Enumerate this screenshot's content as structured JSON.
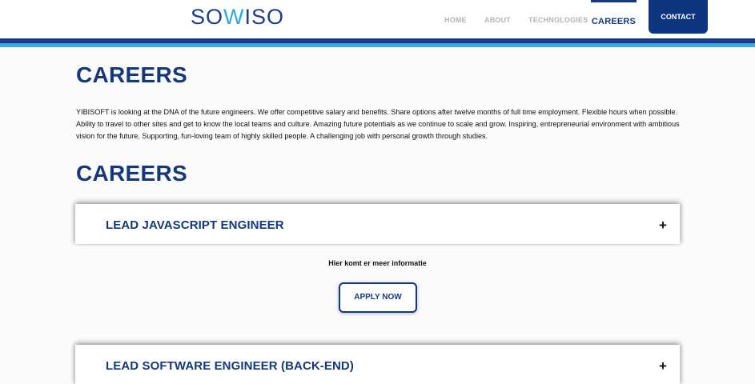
{
  "header": {
    "logo_prefix": "SO",
    "logo_accent": "W",
    "logo_suffix": "ISO",
    "nav": {
      "home": "HOME",
      "about": "ABOUT",
      "technologies": "TECHNOLOGIES",
      "careers": "CAREERS",
      "contact": "CONTACT"
    }
  },
  "main": {
    "heading_1": "CAREERS",
    "intro": "YIBISOFT is looking at the DNA of the future engineers. We offer competitive salary and benefits. Share options after twelve months of full time employment. Flexible hours when possible. Ability to travel to other sites and get to know the local teams and culture. Amazing future potentials as we continue to scale and grow. Inspiring, entrepreneurial environment with ambitious vision for the future. Supporting, fun-loving team of highly skilled people. A challenging job with personal growth through studies.",
    "heading_2": "CAREERS",
    "jobs": [
      {
        "title": "LEAD JAVASCRIPT ENGINEER",
        "toggle": "+",
        "details": "Hier komt er meer informatie",
        "apply_label": "APPLY NOW"
      },
      {
        "title": "LEAD SOFTWARE ENGINEER (BACK-END)",
        "toggle": "+"
      }
    ]
  },
  "colors": {
    "brand_dark": "#15387c",
    "brand_light": "#3aa7e4",
    "nav_inactive": "#b4b4b4"
  }
}
